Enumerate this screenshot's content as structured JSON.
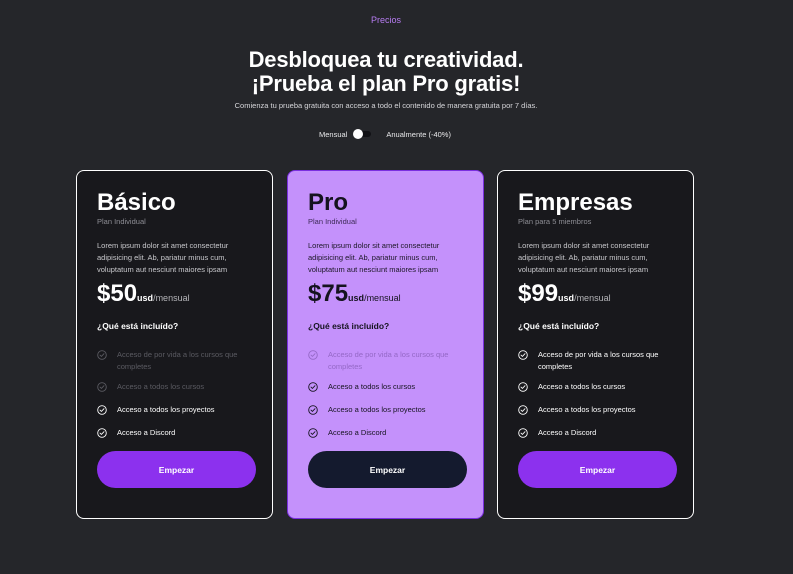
{
  "header": {
    "eyebrow": "Precios",
    "headline_line1": "Desbloquea tu creatividad.",
    "headline_line2": "¡Prueba el plan Pro gratis!",
    "subline": "Comienza tu prueba gratuita con acceso a todo el contenido de manera gratuita por 7 días."
  },
  "billing_toggle": {
    "monthly_label": "Mensual",
    "annual_label": "Anualmente (-40%)",
    "selected": "Mensual"
  },
  "colors": {
    "accent": "#8c31ee",
    "pro_card": "#c491fb",
    "background": "#25262a"
  },
  "plans": [
    {
      "name": "Básico",
      "subtitle": "Plan Individual",
      "description": "Lorem ipsum dolor sit amet consectetur adipisicing elit. Ab, pariatur minus cum, voluptatum aut nesciunt maiores ipsam",
      "price": "$50",
      "currency": "usd",
      "period": "/mensual",
      "included_title": "¿Qué está incluído?",
      "features": [
        {
          "text": "Acceso de por vida a los cursos que completes",
          "enabled": false,
          "icon": "check-circle-icon"
        },
        {
          "text": "Acceso a todos los cursos",
          "enabled": false,
          "icon": "check-circle-icon"
        },
        {
          "text": "Acceso a todos los proyectos",
          "enabled": true,
          "icon": "check-circle-icon"
        },
        {
          "text": "Acceso a Discord",
          "enabled": true,
          "icon": "check-circle-icon"
        }
      ],
      "cta": "Empezar"
    },
    {
      "name": "Pro",
      "subtitle": "Plan Individual",
      "description": "Lorem ipsum dolor sit amet consectetur adipisicing elit. Ab, pariatur minus cum, voluptatum aut nesciunt maiores ipsam",
      "price": "$75",
      "currency": "usd",
      "period": "/mensual",
      "included_title": "¿Qué está incluído?",
      "features": [
        {
          "text": "Acceso de por vida a los cursos que completes",
          "enabled": false,
          "icon": "check-circle-icon"
        },
        {
          "text": "Acceso a todos los cursos",
          "enabled": true,
          "icon": "check-circle-icon"
        },
        {
          "text": "Acceso a todos los proyectos",
          "enabled": true,
          "icon": "check-circle-icon"
        },
        {
          "text": "Acceso a Discord",
          "enabled": true,
          "icon": "check-circle-icon"
        }
      ],
      "cta": "Empezar"
    },
    {
      "name": "Empresas",
      "subtitle": "Plan para 5 miembros",
      "description": "Lorem ipsum dolor sit amet consectetur adipisicing elit. Ab, pariatur minus cum, voluptatum aut nesciunt maiores ipsam",
      "price": "$99",
      "currency": "usd",
      "period": "/mensual",
      "included_title": "¿Qué está incluído?",
      "features": [
        {
          "text": "Acceso de por vida a los cursos que completes",
          "enabled": true,
          "icon": "check-circle-icon"
        },
        {
          "text": "Acceso a todos los cursos",
          "enabled": true,
          "icon": "check-circle-icon"
        },
        {
          "text": "Acceso a todos los proyectos",
          "enabled": true,
          "icon": "check-circle-icon"
        },
        {
          "text": "Acceso a Discord",
          "enabled": true,
          "icon": "check-circle-icon"
        }
      ],
      "cta": "Empezar"
    }
  ]
}
